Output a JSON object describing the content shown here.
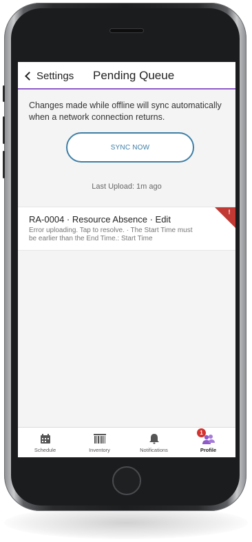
{
  "nav": {
    "back_label": "Settings",
    "title": "Pending Queue"
  },
  "info_text": "Changes made while offline will sync automatically when a network connection returns.",
  "sync_button_label": "SYNC NOW",
  "last_upload": "Last Upload: 1m ago",
  "queue_item": {
    "title": "RA-0004  ·  Resource Absence  ·  Edit",
    "subtitle": "Error uploading. Tap to resolve.  ·  The Start Time must be earlier than the End Time.: Start Time",
    "error_symbol": "!"
  },
  "tabs": [
    {
      "label": "Schedule",
      "icon": "calendar-icon"
    },
    {
      "label": "Inventory",
      "icon": "barcode-icon"
    },
    {
      "label": "Notifications",
      "icon": "bell-icon"
    },
    {
      "label": "Profile",
      "icon": "people-icon",
      "badge": "1",
      "active": true
    }
  ],
  "colors": {
    "accent": "#8e5bc9",
    "sync_border": "#3d7ea6",
    "error": "#c23934",
    "badge": "#d2332f"
  }
}
